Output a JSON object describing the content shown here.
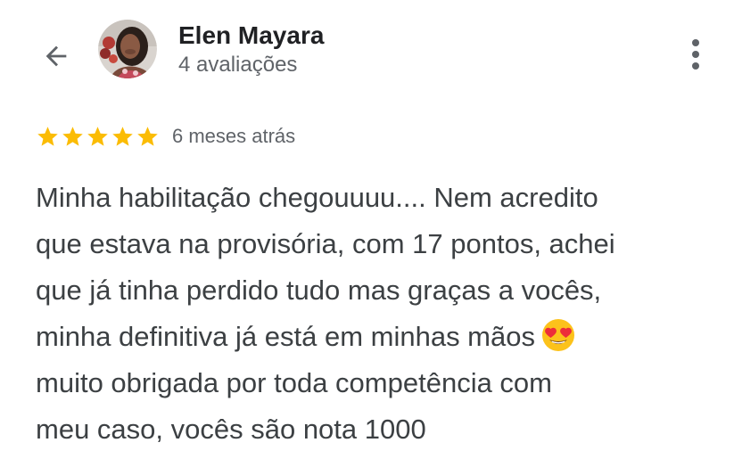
{
  "header": {
    "user_name": "Elen Mayara",
    "review_count": "4 avaliações"
  },
  "review": {
    "rating": 5,
    "rating_max": 5,
    "time_ago": "6 meses atrás",
    "text_lines": [
      "Minha habilitação chegouuuu.... Nem acredito",
      "que estava na provisória, com 17 pontos, achei",
      "que já tinha perdido tudo mas graças a vocês,",
      "minha definitiva já está em minhas mãos",
      "muito obrigada por toda competência com",
      "meu caso, vocês são nota 1000"
    ]
  },
  "colors": {
    "star": "#fbbc04",
    "icon": "#5f6368",
    "name": "#202124",
    "text": "#3c4043",
    "secondary_text": "#5f6368"
  },
  "icons": {
    "back": "arrow-back-icon",
    "more": "more-vert-icon",
    "emoji": "heart-eyes-emoji-icon"
  }
}
